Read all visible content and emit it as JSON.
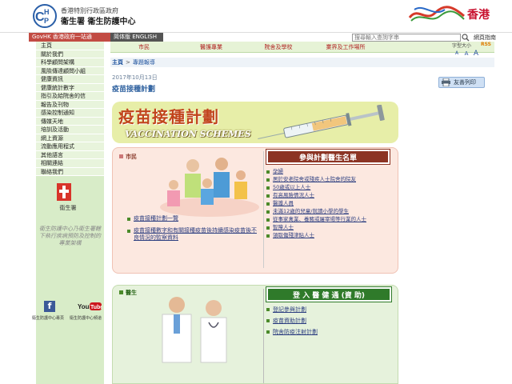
{
  "header": {
    "logo_letters": "CHP",
    "org_line1": "香港特別行政區政府",
    "org_line2": "衞生署 衞生防護中心",
    "brand_text": "香港"
  },
  "govbar": {
    "govhk_label": "GovHK 香港政府一站通",
    "lang_label": "简体版  ENGLISH",
    "search_placeholder": "搜尋輸入查詢字串",
    "sitemap_label": "網頁指南"
  },
  "sidebar": {
    "items": [
      {
        "label": "主頁"
      },
      {
        "label": "關於我們"
      },
      {
        "label": "科學顧問架構"
      },
      {
        "label": "風險傳達顧問小組"
      },
      {
        "label": "健康資訊"
      },
      {
        "label": "健康統計數字"
      },
      {
        "label": "指引及給院舍的信"
      },
      {
        "label": "報告及刊物"
      },
      {
        "label": "感染控制通知"
      },
      {
        "label": "傳媒天地"
      },
      {
        "label": "培訓及活動"
      },
      {
        "label": "網上資源"
      },
      {
        "label": "流動應用程式"
      },
      {
        "label": "其他語言"
      },
      {
        "label": "相關連結"
      },
      {
        "label": "聯絡我們"
      }
    ],
    "dh_label": "衞生署",
    "slogan": "衞生防護中心乃衞生署轄下執行疾病預防及控制的專業架構",
    "facebook_label": "衞生防護中心專頁",
    "youtube_label": "衞生防護中心頻道",
    "youtube_text": "YouTube"
  },
  "topnav": {
    "items": [
      {
        "label": "市民"
      },
      {
        "label": "醫護專業"
      },
      {
        "label": "院舍及學校"
      },
      {
        "label": "業界及工作場所"
      }
    ],
    "font_size_label": "字型大小",
    "font_sizes": [
      "A",
      "A",
      "A"
    ],
    "rss_label": "RSS"
  },
  "breadcrumb": {
    "home": "主頁",
    "separator": ">",
    "current": "專題報導"
  },
  "content": {
    "date": "2017年10月13日",
    "title": "疫苗接種計劃",
    "print_label": "友善列印",
    "banner_title": "疫苗接種計劃",
    "banner_subtitle": "VACCINATION SCHEMES"
  },
  "citizen": {
    "label": "市民",
    "links": [
      {
        "label": "疫苗接種計劃一覽"
      },
      {
        "label": "疫苗接種數字和有關接種疫苗後持續感染疫苗後不良情況的監察資料"
      }
    ],
    "list_header": "參與計劃醫生名單",
    "list_items": [
      {
        "label": "孕婦"
      },
      {
        "label": "居於安老院舍或殘疾人士院舍的院友"
      },
      {
        "label": "50歲或以上人士"
      },
      {
        "label": "有高風險情況人士"
      },
      {
        "label": "醫護人員"
      },
      {
        "label": "未滿12歲的兒童/就讀小學的學生"
      },
      {
        "label": "從事家禽業、養豬或屠宰場等行業的人士"
      },
      {
        "label": "智障人士"
      },
      {
        "label": "領取傷殘津貼人士"
      }
    ]
  },
  "doctor": {
    "label": "醫生",
    "ehr_header": "登 入 醫 健 通 (資 助)",
    "links": [
      {
        "label": "登記參與計劃"
      },
      {
        "label": "疫苗資助計劃"
      },
      {
        "label": "院舍防疫注射計劃"
      }
    ]
  },
  "colors": {
    "gov_red": "#c24b43",
    "nav_red": "#b02020",
    "title_blue": "#2c5f9e",
    "list_header_brown": "#8c3424",
    "ehr_header_green": "#2f7a2a",
    "sidebar_green": "#d8ecc8"
  },
  "icons": [
    "chp-logo-icon",
    "search-icon",
    "rss-icon",
    "print-icon",
    "facebook-icon",
    "youtube-icon",
    "dh-logo-icon"
  ]
}
